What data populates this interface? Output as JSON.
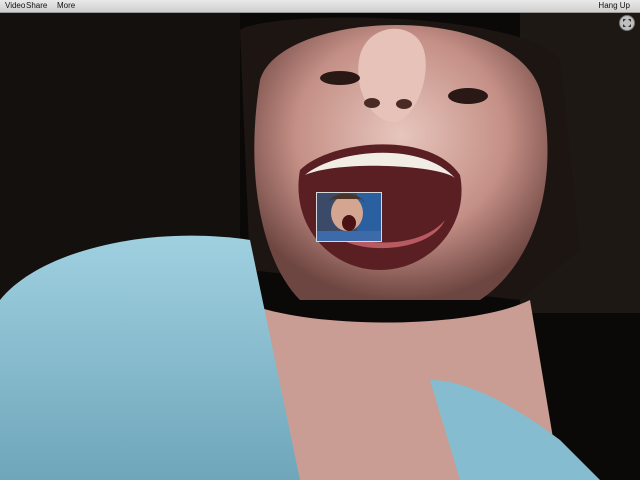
{
  "menu": {
    "video_label": "Video",
    "share_label": "Share",
    "more_label": "More",
    "hang_up_label": "Hang Up"
  },
  "icons": {
    "fullscreen": "fullscreen-icon"
  },
  "colors": {
    "menubar": "#dcdcdc",
    "shirt": "#8fc4d6",
    "background": "#000000"
  }
}
